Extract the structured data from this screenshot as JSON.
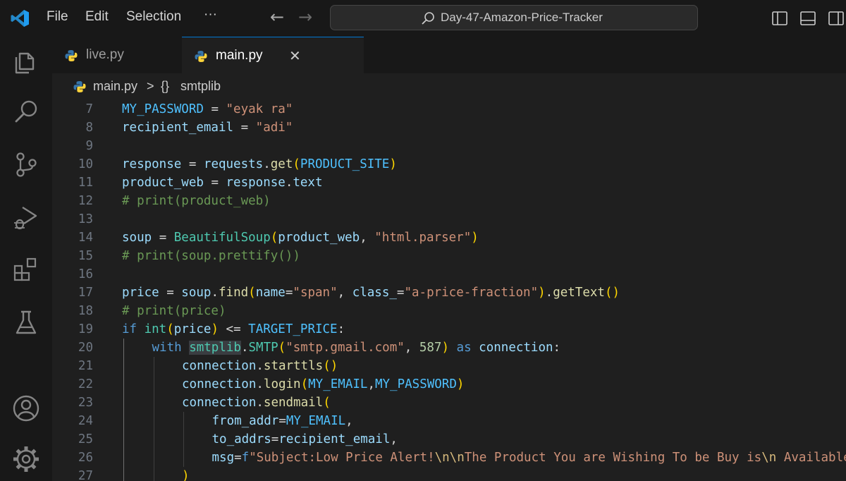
{
  "menu": {
    "file": "File",
    "edit": "Edit",
    "selection": "Selection",
    "more": "···"
  },
  "nav": {
    "back": "←",
    "forward": "→"
  },
  "command_center": {
    "text": "Day-47-Amazon-Price-Tracker"
  },
  "tabs": [
    {
      "label": "live.py",
      "active": false
    },
    {
      "label": "main.py",
      "active": true,
      "close": "✕"
    }
  ],
  "breadcrumb": {
    "file": "main.py",
    "separator": ">",
    "symbol_icon": "{}",
    "symbol": "smtplib"
  },
  "colors": {
    "accent": "#0078d4",
    "python_blue": "#3776ab",
    "python_yellow": "#ffd43b"
  },
  "icons": [
    "vscode-logo-icon",
    "search-icon",
    "toggle-primary-sidebar-icon",
    "toggle-panel-icon",
    "toggle-secondary-sidebar-icon",
    "explorer-icon",
    "search-activity-icon",
    "source-control-icon",
    "run-debug-icon",
    "extensions-icon",
    "testing-icon",
    "accounts-icon",
    "manage-gear-icon",
    "python-file-icon",
    "close-icon"
  ],
  "code_lines": [
    {
      "n": "7",
      "indent": 0,
      "tokens": [
        [
          "MY_PASSWORD",
          "tc"
        ],
        [
          " = ",
          "to"
        ],
        [
          "\"eyak ra\"",
          "ts"
        ]
      ]
    },
    {
      "n": "8",
      "indent": 0,
      "tokens": [
        [
          "recipient_email",
          "tv"
        ],
        [
          " = ",
          "to"
        ],
        [
          "\"adi\"",
          "ts"
        ]
      ]
    },
    {
      "n": "9",
      "indent": 0,
      "tokens": []
    },
    {
      "n": "10",
      "indent": 0,
      "tokens": [
        [
          "response",
          "tv"
        ],
        [
          " = ",
          "to"
        ],
        [
          "requests",
          "tv"
        ],
        [
          ".",
          "to"
        ],
        [
          "get",
          "tf"
        ],
        [
          "(",
          "tb1"
        ],
        [
          "PRODUCT_SITE",
          "tc"
        ],
        [
          ")",
          "tb1"
        ]
      ]
    },
    {
      "n": "11",
      "indent": 0,
      "tokens": [
        [
          "product_web",
          "tv"
        ],
        [
          " = ",
          "to"
        ],
        [
          "response",
          "tv"
        ],
        [
          ".",
          "to"
        ],
        [
          "text",
          "tv"
        ]
      ]
    },
    {
      "n": "12",
      "indent": 0,
      "tokens": [
        [
          "# print(product_web)",
          "tm"
        ]
      ]
    },
    {
      "n": "13",
      "indent": 0,
      "tokens": []
    },
    {
      "n": "14",
      "indent": 0,
      "tokens": [
        [
          "soup",
          "tv"
        ],
        [
          " = ",
          "to"
        ],
        [
          "BeautifulSoup",
          "tt"
        ],
        [
          "(",
          "tb1"
        ],
        [
          "product_web",
          "tv"
        ],
        [
          ", ",
          "to"
        ],
        [
          "\"html.parser\"",
          "ts"
        ],
        [
          ")",
          "tb1"
        ]
      ]
    },
    {
      "n": "15",
      "indent": 0,
      "tokens": [
        [
          "# print(soup.prettify())",
          "tm"
        ]
      ]
    },
    {
      "n": "16",
      "indent": 0,
      "tokens": []
    },
    {
      "n": "17",
      "indent": 0,
      "tokens": [
        [
          "price",
          "tv"
        ],
        [
          " = ",
          "to"
        ],
        [
          "soup",
          "tv"
        ],
        [
          ".",
          "to"
        ],
        [
          "find",
          "tf"
        ],
        [
          "(",
          "tb1"
        ],
        [
          "name",
          "tv"
        ],
        [
          "=",
          "to"
        ],
        [
          "\"span\"",
          "ts"
        ],
        [
          ", ",
          "to"
        ],
        [
          "class_",
          "tv"
        ],
        [
          "=",
          "to"
        ],
        [
          "\"a-price-fraction\"",
          "ts"
        ],
        [
          ")",
          "tb1"
        ],
        [
          ".",
          "to"
        ],
        [
          "getText",
          "tf"
        ],
        [
          "()",
          "tb1"
        ]
      ]
    },
    {
      "n": "18",
      "indent": 0,
      "tokens": [
        [
          "# print(price)",
          "tm"
        ]
      ]
    },
    {
      "n": "19",
      "indent": 0,
      "tokens": [
        [
          "if ",
          "tk"
        ],
        [
          "int",
          "tt"
        ],
        [
          "(",
          "tb1"
        ],
        [
          "price",
          "tv"
        ],
        [
          ")",
          "tb1"
        ],
        [
          " <= ",
          "to"
        ],
        [
          "TARGET_PRICE",
          "tc"
        ],
        [
          ":",
          "to"
        ]
      ]
    },
    {
      "n": "20",
      "indent": 1,
      "tokens": [
        [
          "with ",
          "tk"
        ],
        [
          "smtplib",
          "tt",
          "hl"
        ],
        [
          ".",
          "to"
        ],
        [
          "SMTP",
          "tt"
        ],
        [
          "(",
          "tb1"
        ],
        [
          "\"smtp.gmail.com\"",
          "ts"
        ],
        [
          ", ",
          "to"
        ],
        [
          "587",
          "tn"
        ],
        [
          ")",
          "tb1"
        ],
        [
          " as ",
          "tk"
        ],
        [
          "connection",
          "tv"
        ],
        [
          ":",
          "to"
        ]
      ]
    },
    {
      "n": "21",
      "indent": 2,
      "tokens": [
        [
          "connection",
          "tv"
        ],
        [
          ".",
          "to"
        ],
        [
          "starttls",
          "tf"
        ],
        [
          "()",
          "tb1"
        ]
      ]
    },
    {
      "n": "22",
      "indent": 2,
      "tokens": [
        [
          "connection",
          "tv"
        ],
        [
          ".",
          "to"
        ],
        [
          "login",
          "tf"
        ],
        [
          "(",
          "tb1"
        ],
        [
          "MY_EMAIL",
          "tc"
        ],
        [
          ",",
          "to"
        ],
        [
          "MY_PASSWORD",
          "tc"
        ],
        [
          ")",
          "tb1"
        ]
      ]
    },
    {
      "n": "23",
      "indent": 2,
      "tokens": [
        [
          "connection",
          "tv"
        ],
        [
          ".",
          "to"
        ],
        [
          "sendmail",
          "tf"
        ],
        [
          "(",
          "tb1"
        ]
      ]
    },
    {
      "n": "24",
      "indent": 3,
      "tokens": [
        [
          "from_addr",
          "tv"
        ],
        [
          "=",
          "to"
        ],
        [
          "MY_EMAIL",
          "tc"
        ],
        [
          ",",
          "to"
        ]
      ]
    },
    {
      "n": "25",
      "indent": 3,
      "tokens": [
        [
          "to_addrs",
          "tv"
        ],
        [
          "=",
          "to"
        ],
        [
          "recipient_email",
          "tv"
        ],
        [
          ",",
          "to"
        ]
      ]
    },
    {
      "n": "26",
      "indent": 3,
      "tokens": [
        [
          "msg",
          "tv"
        ],
        [
          "=",
          "to"
        ],
        [
          "f",
          "tk"
        ],
        [
          "\"Subject:Low Price Alert!",
          "ts"
        ],
        [
          "\\n\\n",
          "te"
        ],
        [
          "The Product You are Wishing To be Buy is",
          "ts"
        ],
        [
          "\\n",
          "te"
        ],
        [
          " Available",
          "ts"
        ]
      ]
    },
    {
      "n": "27",
      "indent": 2,
      "tokens": [
        [
          ")",
          "tb1"
        ]
      ]
    }
  ]
}
